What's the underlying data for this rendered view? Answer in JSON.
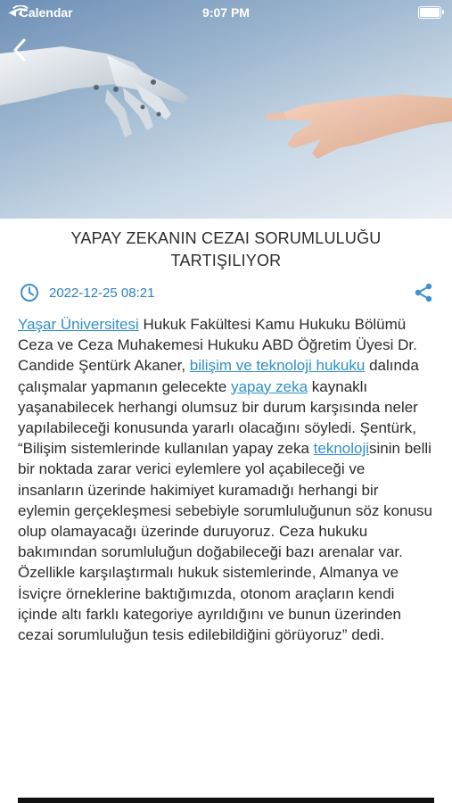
{
  "status_bar": {
    "back_app": "Calendar",
    "time": "9:07 PM",
    "icons": [
      "back-triangle-icon",
      "wifi-icon",
      "battery-icon"
    ]
  },
  "article": {
    "title": "YAPAY ZEKANIN CEZAI SORUMLULUĞU TARTIŞILIYOR",
    "date": "2022-12-25 08:21",
    "body": {
      "link_1": "Yaşar Üniversitesi",
      "text_1": " Hukuk Fakültesi Kamu Hukuku Bölümü Ceza ve Ceza Muhakemesi Hukuku ABD Öğretim Üyesi Dr. Candide Şentürk Akaner, ",
      "link_2": "bilişim ve teknoloji hukuku",
      "text_2": " dalında çalışmalar yapmanın gelecekte ",
      "link_3": "yapay zeka",
      "text_3": " kaynaklı yaşanabilecek herhangi olumsuz bir durum karşısında neler yapılabileceği konusunda yararlı olacağını söyledi. Şentürk, “Bilişim sistemlerinde kullanılan yapay zeka ",
      "link_4": "teknoloji",
      "text_4": "sinin belli bir noktada zarar verici eylemlere yol açabileceği ve insanların üzerinde hakimiyet kuramadığı herhangi bir eylemin gerçekleşmesi sebebiyle sorumluluğunun söz konusu olup olamayacağı üzerinde duruyoruz. Ceza hukuku bakımından sorumluluğun doğabileceği bazı arenalar var. Özellikle karşılaştırmalı hukuk sistemlerinde, Almanya ve İsviçre örneklerine baktığımızda, otonom araçların kendi içinde altı farklı kategoriye ayrıldığını ve bunun üzerinden cezai sorumluluğun tesis edilebildiğini görüyoruz” dedi."
    }
  },
  "colors": {
    "link": "#2f8fc9",
    "date": "#2f7fbf",
    "icon": "#3d8fd0",
    "text": "#2c2c2c"
  }
}
